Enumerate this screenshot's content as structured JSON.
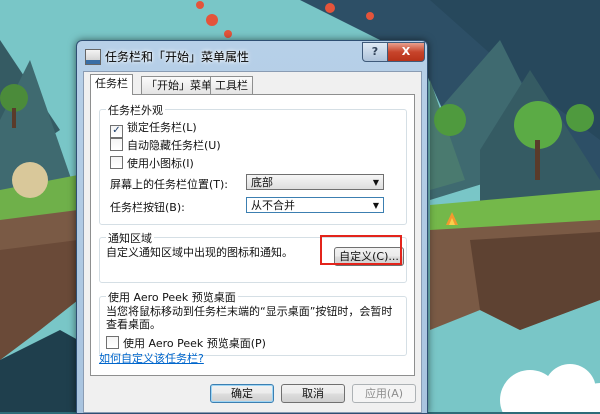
{
  "window": {
    "title": "任务栏和「开始」菜单属性",
    "help_label": "?",
    "close_label": "X"
  },
  "tabs": [
    {
      "label": "任务栏",
      "active": true
    },
    {
      "label": "「开始」菜单",
      "active": false
    },
    {
      "label": "工具栏",
      "active": false
    }
  ],
  "appearance": {
    "group_title": "任务栏外观",
    "lock_label": "锁定任务栏(L)",
    "lock_checked": true,
    "autohide_label": "自动隐藏任务栏(U)",
    "autohide_checked": false,
    "small_icons_label": "使用小图标(I)",
    "small_icons_checked": false,
    "location_label": "屏幕上的任务栏位置(T):",
    "location_value": "底部",
    "buttons_label": "任务栏按钮(B):",
    "buttons_value": "从不合并"
  },
  "notification": {
    "group_title": "通知区域",
    "description": "自定义通知区域中出现的图标和通知。",
    "customize_button": "自定义(C)..."
  },
  "aero_peek": {
    "group_title": "使用 Aero Peek 预览桌面",
    "description_line1": "当您将鼠标移动到任务栏末端的“显示桌面”按钮时，会暂时",
    "description_line2": "查看桌面。",
    "checkbox_label": "使用 Aero Peek 预览桌面(P)",
    "checked": false
  },
  "help_link": "如何自定义该任务栏?",
  "footer": {
    "ok": "确定",
    "cancel": "取消",
    "apply": "应用(A)"
  },
  "colors": {
    "sky": "#7ec8c9",
    "highlight": "#e3241b",
    "link": "#0066cc"
  }
}
